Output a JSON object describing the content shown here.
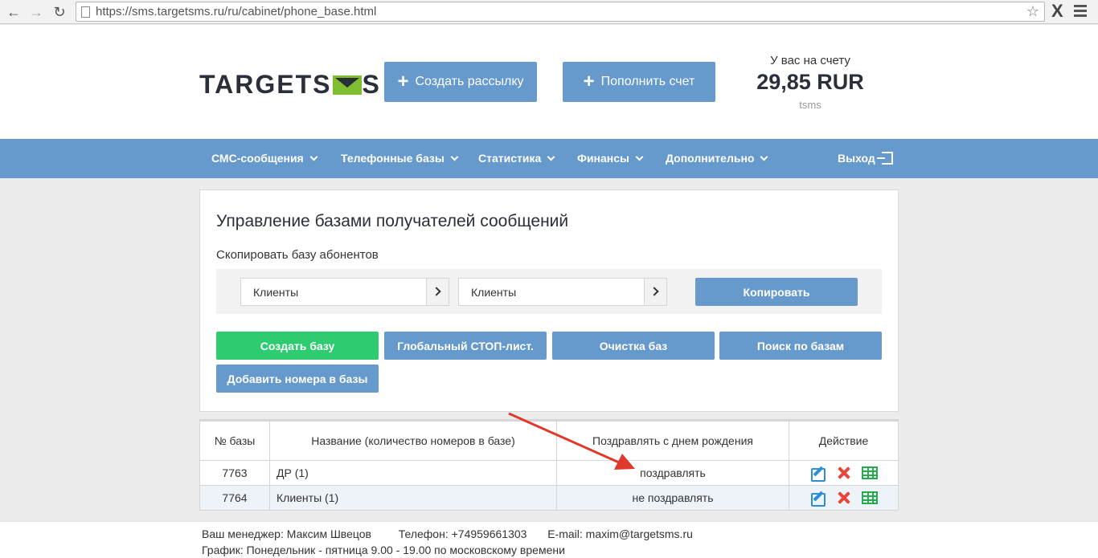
{
  "browser": {
    "url": "https://sms.targetsms.ru/ru/cabinet/phone_base.html",
    "back_icon": "arrow-left-icon",
    "forward_icon": "arrow-right-icon",
    "reload_icon": "reload-icon",
    "bookmark_icon": "star-icon",
    "extension_label": "X"
  },
  "header": {
    "logo_left": "TARGETS",
    "logo_right": "S",
    "create_mailing": "Создать рассылку",
    "top_up": "Пополнить счет",
    "balance_label": "У вас на счету",
    "balance_value": "29,85 RUR",
    "balance_unit": "tsms"
  },
  "nav": {
    "items": [
      {
        "label": "СМС-сообщения"
      },
      {
        "label": "Телефонные базы"
      },
      {
        "label": "Статистика"
      },
      {
        "label": "Финансы"
      },
      {
        "label": "Дополнительно"
      }
    ],
    "logout": "Выход"
  },
  "panel": {
    "title": "Управление базами получателей сообщений",
    "copy_label": "Скопировать базу абонентов",
    "source_select": "Клиенты",
    "target_select": "Клиенты",
    "copy_button": "Копировать",
    "buttons": {
      "create": "Создать базу",
      "global_stop": "Глобальный СТОП-лист.",
      "clean": "Очистка баз",
      "search": "Поиск по базам",
      "add_numbers": "Добавить номера в базы"
    }
  },
  "table": {
    "headers": [
      "№ базы",
      "Название (количество номеров в базе)",
      "Поздравлять с днем рождения",
      "Действие"
    ],
    "rows": [
      {
        "id": "7763",
        "name": "ДР (1)",
        "birthday": "поздравлять"
      },
      {
        "id": "7764",
        "name": "Клиенты (1)",
        "birthday": "не поздравлять"
      }
    ]
  },
  "footer": {
    "manager": "Ваш менеджер: Максим Швецов",
    "phone": "Телефон: +74959661303",
    "email": "E-mail: maxim@targetsms.ru",
    "schedule": "График: Понедельник - пятница 9.00 - 19.00 по московскому времени"
  },
  "colors": {
    "primary": "#6699cc",
    "success": "#2ecc71",
    "annotation_arrow": "#e0392b"
  }
}
